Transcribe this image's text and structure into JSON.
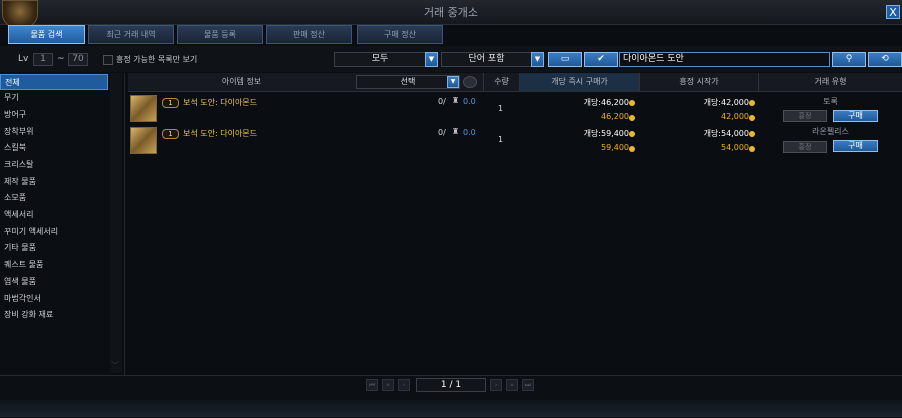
{
  "window": {
    "title": "거래 중개소",
    "close_label": "X"
  },
  "tabs": [
    {
      "label": "물품 검색",
      "active": true
    },
    {
      "label": "최근 거래 내역",
      "active": false
    },
    {
      "label": "물품 등록",
      "active": false
    },
    {
      "label": "판매 정산",
      "active": false
    },
    {
      "label": "구매 정산",
      "active": false
    }
  ],
  "filter": {
    "lv_label": "Lv",
    "lv_min": "1",
    "lv_sep": "~",
    "lv_max": "70",
    "auction_only_label": "흥정 가능한 목록만 보기",
    "grade_select": "모두",
    "match_select": "단어 포함",
    "search_value": "다이아몬드 도안"
  },
  "categories": [
    {
      "label": "전체",
      "selected": true
    },
    {
      "label": "무기",
      "selected": false
    },
    {
      "label": "방어구",
      "selected": false
    },
    {
      "label": "장착부위",
      "selected": false
    },
    {
      "label": "스킬북",
      "selected": false
    },
    {
      "label": "크리스탈",
      "selected": false
    },
    {
      "label": "제작 물품",
      "selected": false
    },
    {
      "label": "소모품",
      "selected": false
    },
    {
      "label": "액세서리",
      "selected": false
    },
    {
      "label": "꾸미기 액세서리",
      "selected": false
    },
    {
      "label": "기타 물품",
      "selected": false
    },
    {
      "label": "퀘스트 물품",
      "selected": false
    },
    {
      "label": "염색 물품",
      "selected": false
    },
    {
      "label": "마법각인서",
      "selected": false
    },
    {
      "label": "장비 강화 재료",
      "selected": false
    }
  ],
  "columns": {
    "item_info": "아이템 정보",
    "select_label": "선택",
    "quantity": "수량",
    "instant_buy": "개당 즉시 구매가",
    "auction_start": "흥정 시작가",
    "trade_type": "거래 유형"
  },
  "rows": [
    {
      "badge": "1",
      "name": "보석 도안: 다이아몬드",
      "bids": "0/",
      "bid_value": "0.0",
      "quantity": "1",
      "instant_each": "개당:46,200",
      "instant_total": "46,200",
      "auction_each": "개당:42,000",
      "auction_total": "42,000",
      "seller": "토록",
      "auction_btn": "흥정",
      "buy_btn": "구매"
    },
    {
      "badge": "1",
      "name": "보석 도안: 다이아몬드",
      "bids": "0/",
      "bid_value": "0.0",
      "quantity": "1",
      "instant_each": "개당:59,400",
      "instant_total": "59,400",
      "auction_each": "개당:54,000",
      "auction_total": "54,000",
      "seller": "라온펠리스",
      "auction_btn": "흥정",
      "buy_btn": "구매"
    }
  ],
  "pagination": {
    "current": "1 / 1"
  },
  "colors": {
    "accent": "#1f5c9d",
    "price": "#f0b020",
    "item_name": "#f1c95a"
  }
}
